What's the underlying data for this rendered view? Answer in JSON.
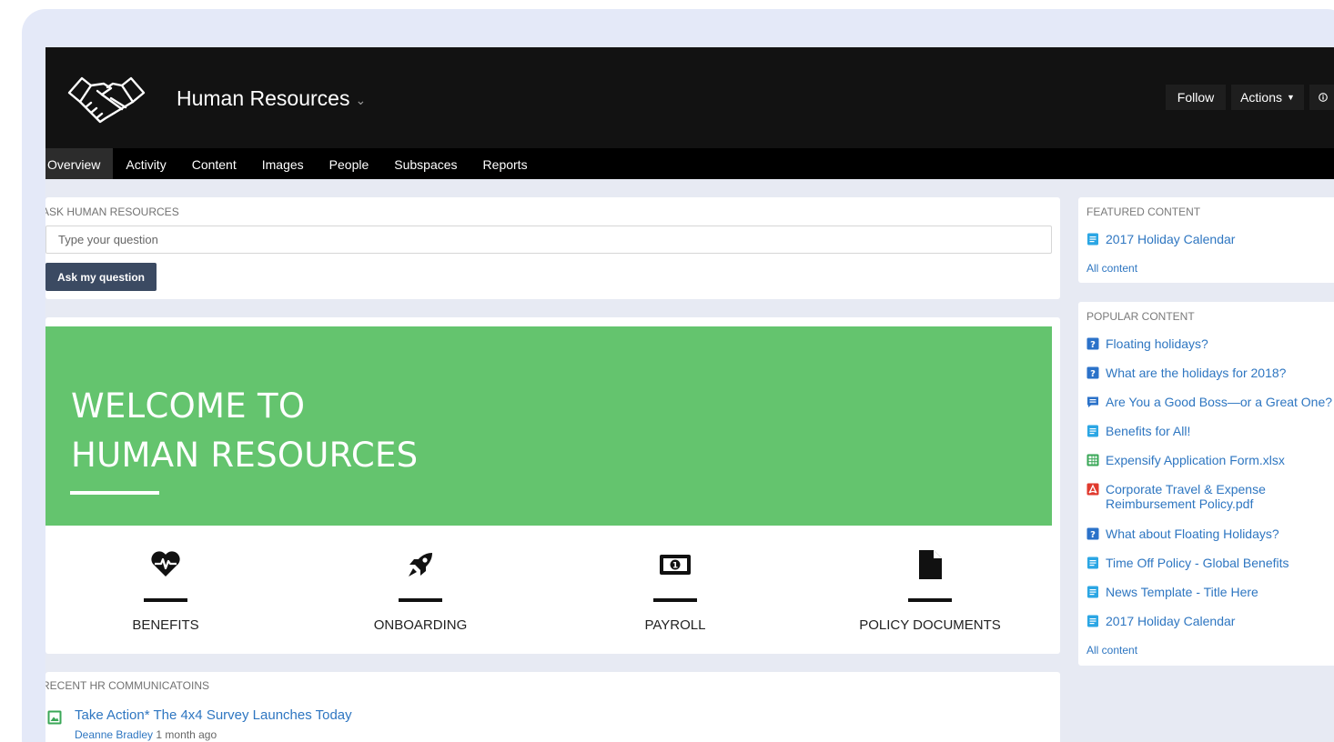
{
  "header": {
    "space_title": "Human Resources",
    "follow_label": "Follow",
    "actions_label": "Actions",
    "info_icon": "info-icon"
  },
  "nav": {
    "tabs": [
      {
        "label": "Overview",
        "active": true
      },
      {
        "label": "Activity"
      },
      {
        "label": "Content"
      },
      {
        "label": "Images"
      },
      {
        "label": "People"
      },
      {
        "label": "Subspaces"
      },
      {
        "label": "Reports"
      }
    ]
  },
  "ask": {
    "heading": "ASK HUMAN RESOURCES",
    "placeholder": "Type your question",
    "button_label": "Ask my question"
  },
  "welcome": {
    "line1": "WELCOME TO",
    "line2": "HUMAN RESOURCES",
    "banner_color": "#64c46e",
    "tiles": [
      {
        "label": "BENEFITS",
        "icon": "heart-pulse-icon"
      },
      {
        "label": "ONBOARDING",
        "icon": "rocket-icon"
      },
      {
        "label": "PAYROLL",
        "icon": "money-bill-icon"
      },
      {
        "label": "POLICY DOCUMENTS",
        "icon": "document-icon"
      }
    ]
  },
  "recent": {
    "heading": "RECENT HR COMMUNICATOINS",
    "items": [
      {
        "title": "Take Action* The 4x4 Survey Launches Today",
        "author": "Deanne Bradley",
        "time": "1 month ago",
        "icon": "image-post-icon"
      }
    ]
  },
  "featured": {
    "heading": "FEATURED CONTENT",
    "items": [
      {
        "title": "2017 Holiday Calendar",
        "icon": "document-icon"
      }
    ],
    "all_label": "All content"
  },
  "popular": {
    "heading": "POPULAR CONTENT",
    "items": [
      {
        "title": "Floating holidays?",
        "icon": "question-icon"
      },
      {
        "title": "What are the holidays for 2018?",
        "icon": "question-icon"
      },
      {
        "title": "Are You a Good Boss—or a Great One?",
        "icon": "blog-post-icon"
      },
      {
        "title": "Benefits for All!",
        "icon": "document-icon"
      },
      {
        "title": "Expensify Application Form.xlsx",
        "icon": "spreadsheet-icon"
      },
      {
        "title": "Corporate Travel & Expense Reimbursement Policy.pdf",
        "icon": "pdf-icon"
      },
      {
        "title": "What about Floating Holidays?",
        "icon": "question-icon"
      },
      {
        "title": "Time Off Policy - Global Benefits",
        "icon": "document-icon"
      },
      {
        "title": "News Template - Title Here",
        "icon": "document-icon"
      },
      {
        "title": "2017 Holiday Calendar",
        "icon": "document-icon"
      }
    ],
    "all_label": "All content"
  }
}
